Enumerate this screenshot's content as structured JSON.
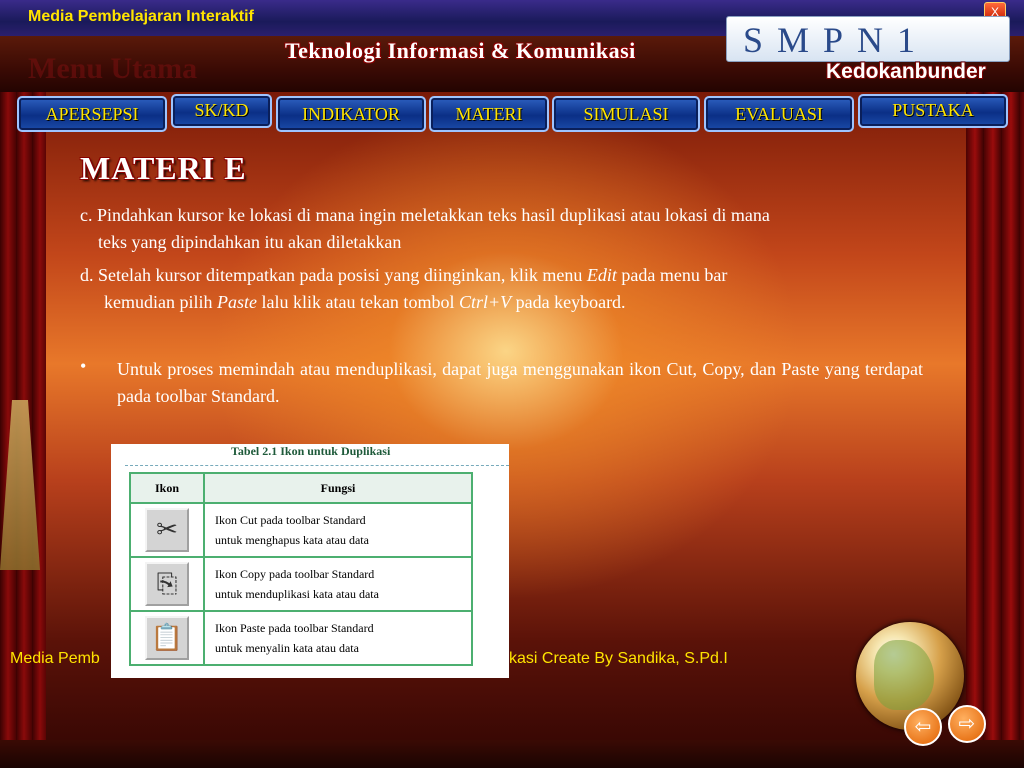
{
  "header": {
    "app_title": "Media Pembelajaran Interaktif",
    "close_label": "X",
    "menu_utama": "Menu Utama",
    "subtitle": "Teknologi Informasi & Komunikasi",
    "school_logo": "SMPN1",
    "school_sub": "Kedokanbunder"
  },
  "nav": {
    "items": [
      {
        "label": "APERSEPSI"
      },
      {
        "label": "SK/KD"
      },
      {
        "label": "INDIKATOR"
      },
      {
        "label": "MATERI"
      },
      {
        "label": "SIMULASI"
      },
      {
        "label": "EVALUASI"
      },
      {
        "label": "PUSTAKA"
      }
    ]
  },
  "content": {
    "title": "MATERI   E",
    "p1_line1": "c. Pindahkan kursor ke lokasi di mana ingin meletakkan teks hasil duplikasi atau lokasi di mana",
    "p1_line2": "teks yang dipindahkan  itu  akan  diletakkan",
    "p2_line1_a": "d. Setelah kursor ditempatkan pada posisi yang diinginkan, klik menu ",
    "p2_line1_em": "Edit",
    "p2_line1_b": " pada menu bar",
    "p2_line2_a": "kemudian pilih ",
    "p2_line2_em1": "Paste",
    "p2_line2_b": " lalu klik atau tekan  tombol  ",
    "p2_line2_em2": "Ctrl+V",
    "p2_line2_c": "  pada  keyboard.",
    "bullet_symbol": "•",
    "bullet_text": "Untuk  proses  memindah  atau  menduplikasi,  dapat  juga menggunakan  ikon  Cut,  Copy,  dan  Paste  yang  terdapat  pada toolbar  Standard."
  },
  "table": {
    "caption": "Tabel  2.1   Ikon   untuk   Duplikasi",
    "headers": [
      "Ikon",
      "Fungsi"
    ],
    "rows": [
      {
        "icon": "scissors-icon",
        "glyph": "✂",
        "line1": "Ikon  Cut  pada  toolbar  Standard",
        "line2": "untuk  menghapus  kata  atau  data"
      },
      {
        "icon": "copy-icon",
        "glyph": "⎘",
        "line1": "Ikon  Copy  pada  toolbar  Standard",
        "line2": "untuk  menduplikasi  kata  atau  data"
      },
      {
        "icon": "paste-icon",
        "glyph": "📋",
        "line1": "Ikon  Paste  pada  toolbar  Standard",
        "line2": "untuk  menyalin  kata  atau  data"
      }
    ]
  },
  "footer": {
    "left": "Media Pemb",
    "right": "kasi Create By Sandika, S.Pd.I"
  },
  "controls": {
    "prev_icon": "arrow-left-icon",
    "next_icon": "arrow-right-icon",
    "prev_glyph": "⇦",
    "next_glyph": "⇨"
  }
}
